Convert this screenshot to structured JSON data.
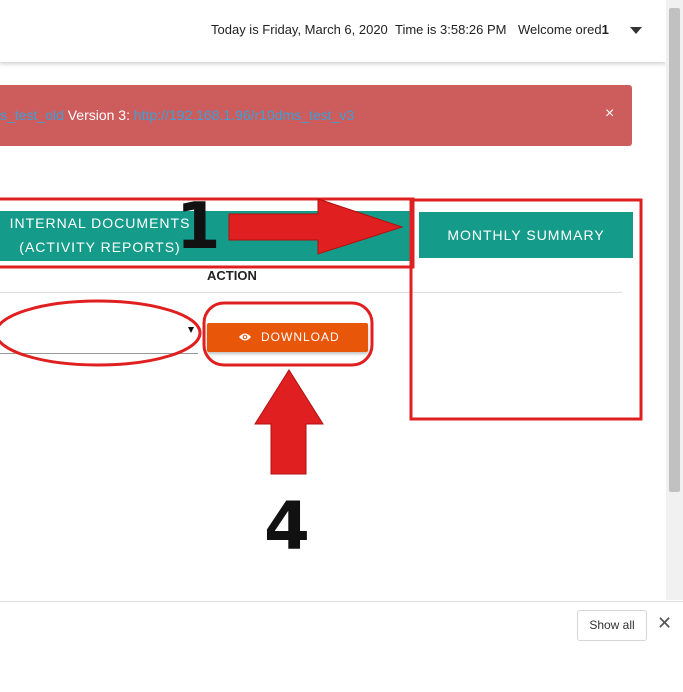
{
  "header": {
    "date_text": "Today is Friday, March 6, 2020",
    "time_text": "Time is 3:58:26 PM",
    "welcome_text": "Welcome ored",
    "user_suffix": "1"
  },
  "alert": {
    "link_old": "s_test_old",
    "version_text": " Version 3: ",
    "link_v3": "http://192.168.1.96/r10dms_test_v3",
    "close_symbol": "×",
    "color": "#cd5c5c"
  },
  "tabs": {
    "internal_line1": "INTERNAL DOCUMENTS",
    "internal_line2": "(ACTIVITY REPORTS)",
    "monthly": "MONTHLY SUMMARY",
    "color": "#159b8a"
  },
  "table": {
    "action_header": "ACTION"
  },
  "download_button": {
    "label": "DOWNLOAD",
    "icon": "eye-icon",
    "color": "#e8560a"
  },
  "annotations": {
    "step_one": "1",
    "step_four": "4",
    "color": "#e02020"
  },
  "download_bar": {
    "show_all": "Show all",
    "close_symbol": "✕"
  }
}
